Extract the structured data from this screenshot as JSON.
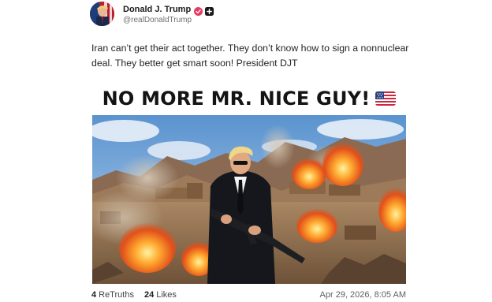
{
  "post": {
    "display_name": "Donald J. Trump",
    "handle": "@realDonaldTrump",
    "verified_icon": "verified-badge-icon",
    "plus_icon": "plus-badge-icon",
    "text": "Iran can’t get their act together. They don’t know how to sign a nonnuclear deal. They better get smart soon! President DJT",
    "headline": "NO MORE MR. NICE GUY!",
    "headline_emoji": "us-flag-icon",
    "stats": {
      "retruths_count": "4",
      "retruths_label": "ReTruths",
      "likes_count": "24",
      "likes_label": "Likes"
    },
    "timestamp": "Apr 29, 2026, 8:05 AM"
  },
  "colors": {
    "verified_badge": "#e8395f",
    "avatar_bg": "#b8202e",
    "text": "#242426",
    "muted": "#707075"
  }
}
